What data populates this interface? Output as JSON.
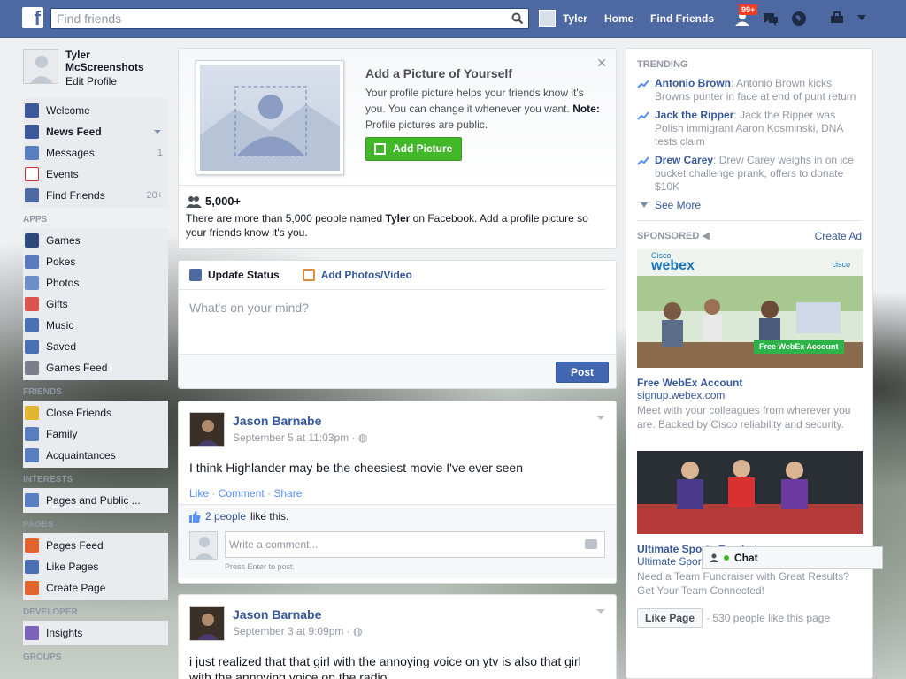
{
  "topbar": {
    "search_placeholder": "Find friends",
    "user_name": "Tyler",
    "home": "Home",
    "find_friends": "Find Friends",
    "notif_badge": "99+"
  },
  "sidebar": {
    "profile_name": "Tyler McScreenshots",
    "edit_profile": "Edit Profile",
    "main_items": [
      {
        "label": "Welcome",
        "count": "",
        "icon": "facebook-icon",
        "color": "#3b5998"
      },
      {
        "label": "News Feed",
        "count": "",
        "icon": "news-feed-icon",
        "color": "#3b5998"
      },
      {
        "label": "Messages",
        "count": "1",
        "icon": "messages-icon",
        "color": "#5a7fc0"
      },
      {
        "label": "Events",
        "count": "",
        "icon": "calendar-icon",
        "color": "#c93030"
      },
      {
        "label": "Find Friends",
        "count": "20+",
        "icon": "friends-icon",
        "color": "#4e69a2"
      }
    ],
    "apps_head": "APPS",
    "apps": [
      {
        "label": "Games",
        "icon": "games-icon",
        "color": "#2d4a7a"
      },
      {
        "label": "Pokes",
        "icon": "pokes-icon",
        "color": "#5b7bc0"
      },
      {
        "label": "Photos",
        "icon": "photos-icon",
        "color": "#6c8ec9"
      },
      {
        "label": "Gifts",
        "icon": "gift-icon",
        "color": "#d9534f"
      },
      {
        "label": "Music",
        "icon": "music-icon",
        "color": "#4a6fb3"
      },
      {
        "label": "Saved",
        "icon": "bookmark-icon",
        "color": "#4a6fb3"
      },
      {
        "label": "Games Feed",
        "icon": "gamepad-icon",
        "color": "#7a7f8a"
      }
    ],
    "friends_head": "FRIENDS",
    "friends": [
      {
        "label": "Close Friends",
        "icon": "star-icon",
        "color": "#e2b530"
      },
      {
        "label": "Family",
        "icon": "family-icon",
        "color": "#5a7fc0"
      },
      {
        "label": "Acquaintances",
        "icon": "acquaintances-icon",
        "color": "#5a7fc0"
      }
    ],
    "interests_head": "INTERESTS",
    "interests": [
      {
        "label": "Pages and Public ...",
        "icon": "pages-public-icon",
        "color": "#5a7fc0"
      }
    ],
    "pages_head": "PAGES",
    "pages": [
      {
        "label": "Pages Feed",
        "icon": "pages-feed-icon",
        "color": "#e0642c"
      },
      {
        "label": "Like Pages",
        "icon": "like-pages-icon",
        "color": "#4a6fb3"
      },
      {
        "label": "Create Page",
        "icon": "plus-icon",
        "color": "#e0642c"
      }
    ],
    "developer_head": "DEVELOPER",
    "developer": [
      {
        "label": "Insights",
        "icon": "insights-icon",
        "color": "#7a63b8"
      }
    ],
    "groups_head": "GROUPS"
  },
  "profile_card": {
    "title": "Add a Picture of Yourself",
    "desc": "Your profile picture helps your friends know it's you. You can change it whenever you want.",
    "note_label": "Note:",
    "note_text": "Profile pictures are public.",
    "button": "Add Picture",
    "count": "5,000+",
    "bottom_pre": "There are more than 5,000 people named",
    "bottom_name": "Tyler",
    "bottom_post": "on Facebook. Add a profile picture so your friends know it's you."
  },
  "composer": {
    "tab_status": "Update Status",
    "tab_photos": "Add Photos/Video",
    "placeholder": "What's on your mind?",
    "post": "Post"
  },
  "posts": [
    {
      "author": "Jason Barnabe",
      "date": "September 5 at 11:03pm ·",
      "body": "I think Highlander may be the cheesiest movie I've ever seen",
      "like": "Like",
      "comment": "Comment",
      "share": "Share",
      "likes_link": "2 people",
      "likes_text": "like this.",
      "comment_placeholder": "Write a comment...",
      "comment_hint": "Press Enter to post."
    },
    {
      "author": "Jason Barnabe",
      "date": "September 3 at 9:09pm ·",
      "body": "i just realized that that girl with the annoying voice on ytv is also that girl with the annoying voice on the radio"
    }
  ],
  "trending": {
    "head": "TRENDING",
    "items": [
      {
        "name": "Antonio Brown",
        "text": ": Antonio Brown kicks Browns punter in face at end of punt return"
      },
      {
        "name": "Jack the Ripper",
        "text": ": Jack the Ripper was Polish immigrant Aaron Kosminski, DNA tests claim"
      },
      {
        "name": "Drew Carey",
        "text": ": Drew Carey weighs in on ice bucket challenge prank, offers to donate $10K"
      }
    ],
    "see_more": "See More"
  },
  "sponsored": {
    "head": "SPONSORED",
    "create_ad": "Create Ad",
    "ad1": {
      "brand_small": "Cisco",
      "brand": "webex",
      "cisco": "cisco",
      "cta": "Free WebEx Account",
      "title": "Free WebEx Account",
      "url": "signup.webex.com",
      "desc": "Meet with your colleagues from wherever you are. Backed by Cisco reliability and security."
    },
    "ad2": {
      "title": "Ultimate Sports Fundraiser",
      "sub": "Ultimate Sports",
      "desc": "Need a Team Fundraiser with Great Results? Get Your Team Connected!",
      "like_btn": "Like Page",
      "like_count": "· 530 people like this page"
    }
  },
  "chat": {
    "label": "Chat"
  }
}
